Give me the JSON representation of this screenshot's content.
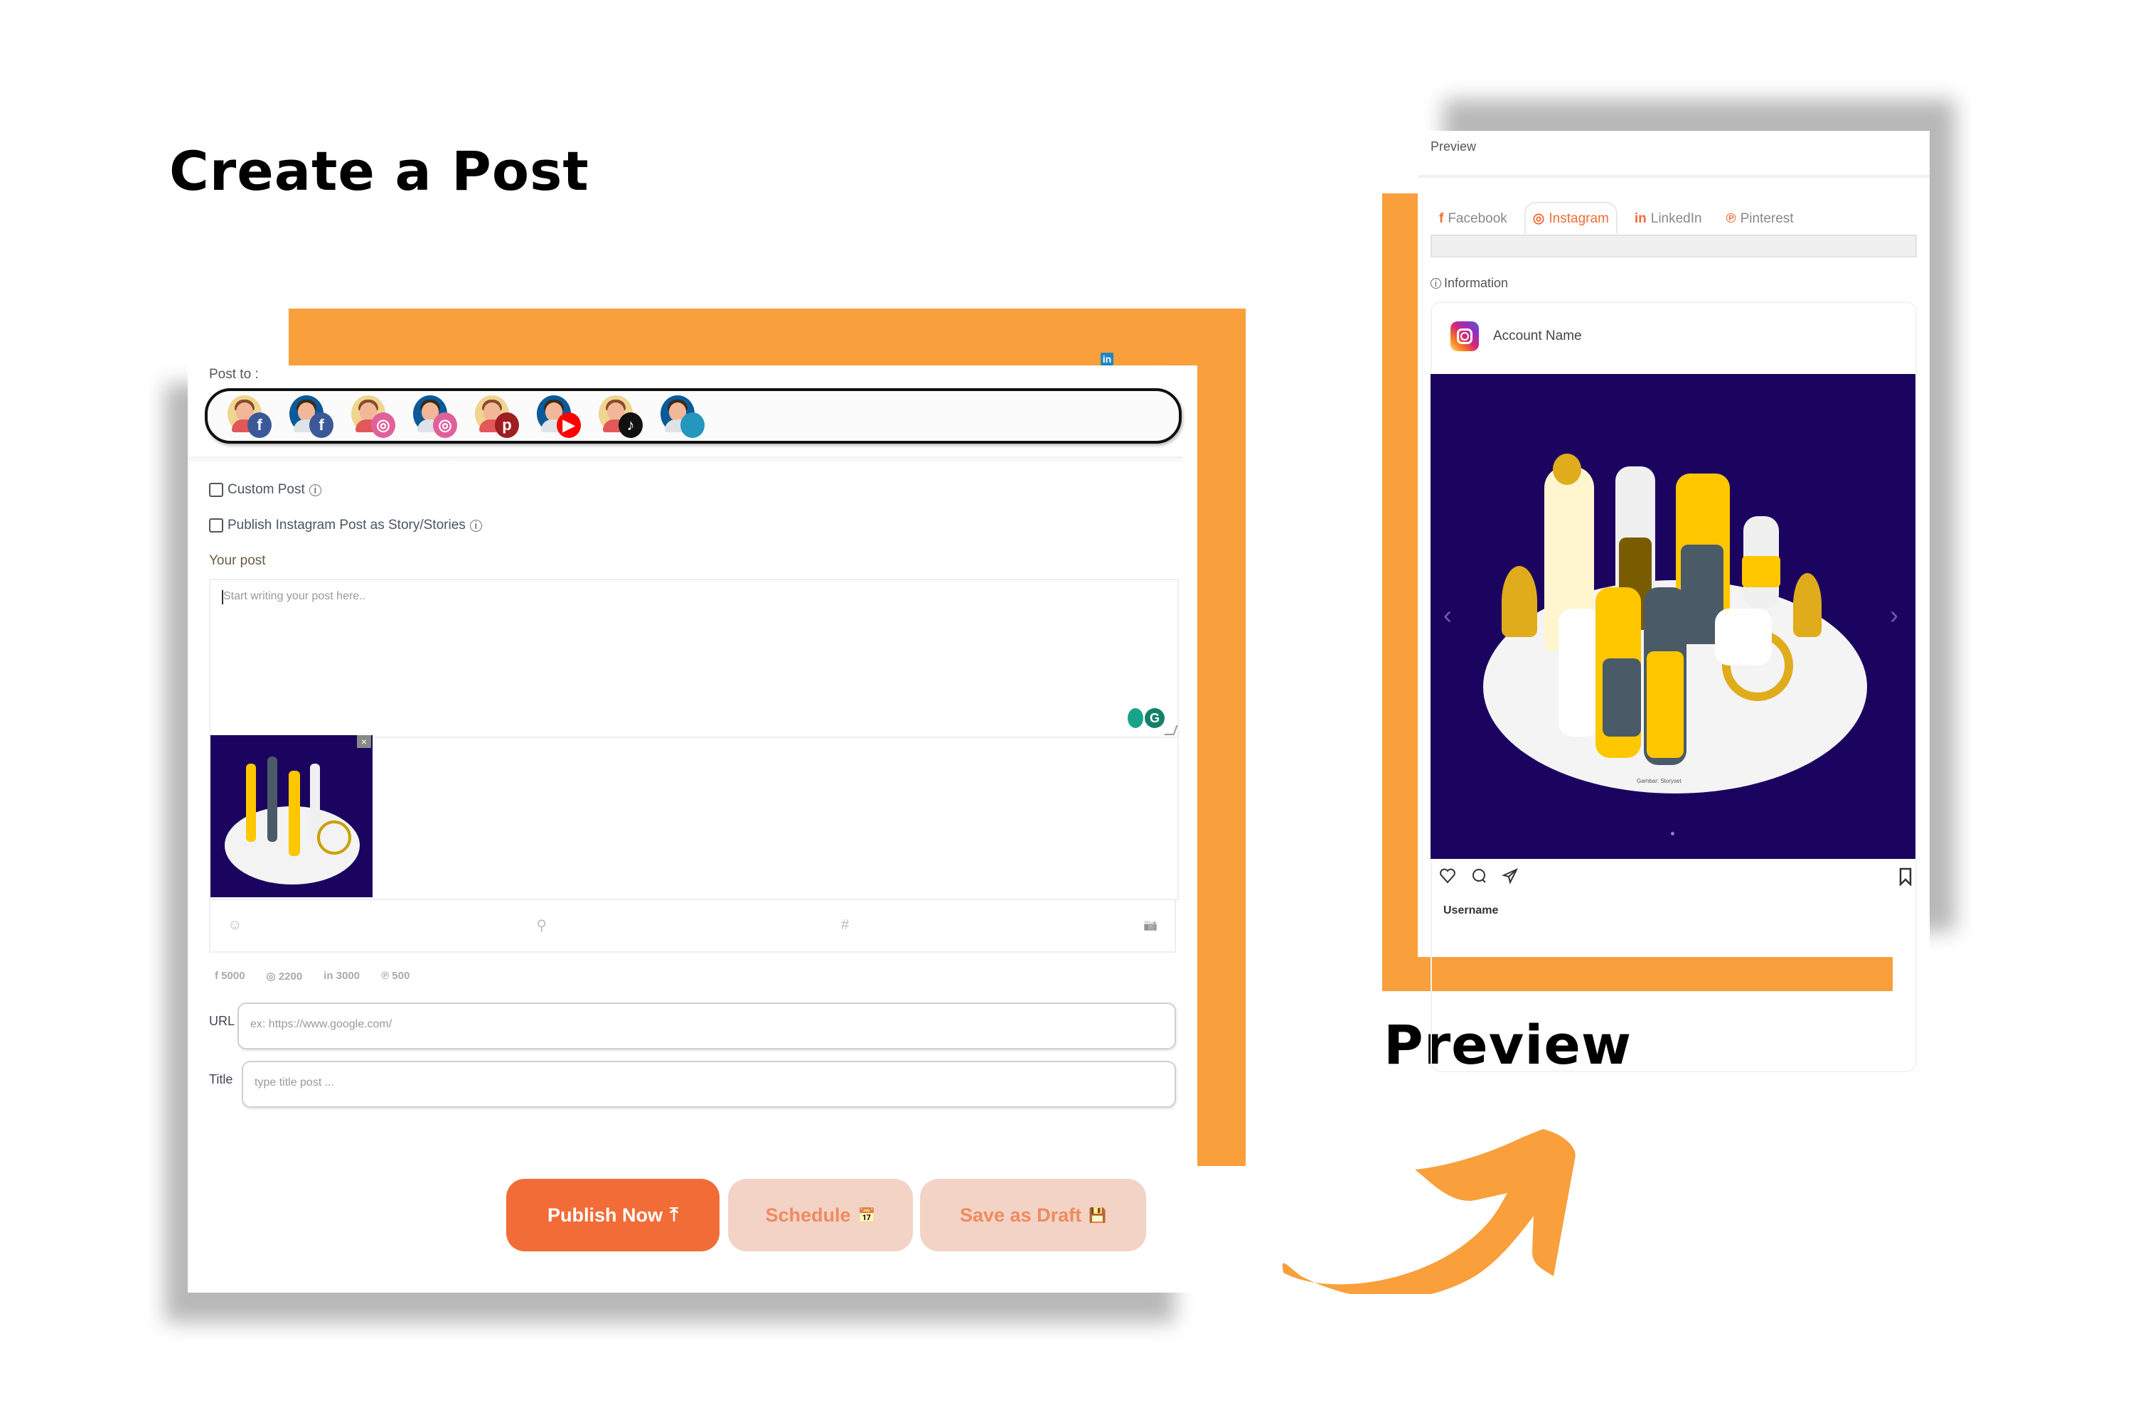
{
  "headings": {
    "create": "Create a Post",
    "preview": "Preview"
  },
  "colors": {
    "accent_orange": "#f99f3b",
    "primary_button": "#f26c37",
    "soft_button": "#f2d3c6",
    "image_bg": "#1b0360"
  },
  "editor": {
    "post_to_label": "Post to :",
    "floating_badge": "in",
    "accounts": [
      {
        "avatar": "female",
        "network": "facebook",
        "glyph": "f",
        "color": "#3b5998"
      },
      {
        "avatar": "male",
        "network": "facebook",
        "glyph": "f",
        "color": "#3b5998"
      },
      {
        "avatar": "female",
        "network": "instagram",
        "glyph": "◎",
        "color": "#e1609a"
      },
      {
        "avatar": "male",
        "network": "instagram",
        "glyph": "◎",
        "color": "#e1609a"
      },
      {
        "avatar": "female",
        "network": "pinterest",
        "glyph": "p",
        "color": "#a01d22"
      },
      {
        "avatar": "male",
        "network": "youtube",
        "glyph": "▶",
        "color": "#f00"
      },
      {
        "avatar": "female",
        "network": "tiktok",
        "glyph": "♪",
        "color": "#111"
      },
      {
        "avatar": "male",
        "network": "other",
        "glyph": "",
        "color": "#2596be"
      }
    ],
    "custom_post_label": "Custom Post",
    "story_label": "Publish Instagram Post as Story/Stories",
    "your_post_label": "Your post",
    "post_placeholder": "Start writing your post here..",
    "image_close": "×",
    "toolbar": {
      "emoji": "☺",
      "location": "⚲",
      "hashtag": "#",
      "camera": "📷"
    },
    "limits": [
      {
        "icon": "f",
        "value": "5000"
      },
      {
        "icon": "◎",
        "value": "2200"
      },
      {
        "icon": "in",
        "value": "3000"
      },
      {
        "icon": "℗",
        "value": "500"
      }
    ],
    "url_label": "URL",
    "url_placeholder": "ex: https://www.google.com/",
    "title_label": "Title",
    "title_placeholder": "type title post ...",
    "buttons": {
      "publish": "Publish Now",
      "publish_icon": "⤒",
      "schedule": "Schedule",
      "schedule_icon": "📅",
      "draft": "Save as Draft",
      "draft_icon": "💾"
    }
  },
  "preview": {
    "header": "Preview",
    "tabs": [
      {
        "icon": "f",
        "label": "Facebook"
      },
      {
        "icon": "◎",
        "label": "Instagram"
      },
      {
        "icon": "in",
        "label": "LinkedIn"
      },
      {
        "icon": "℗",
        "label": "Pinterest"
      }
    ],
    "active_tab": "Instagram",
    "information_label": "Information",
    "account_name": "Account Name",
    "image_caption": "Gambar: Storyset",
    "prev": "‹",
    "next": "›",
    "username": "Username"
  }
}
